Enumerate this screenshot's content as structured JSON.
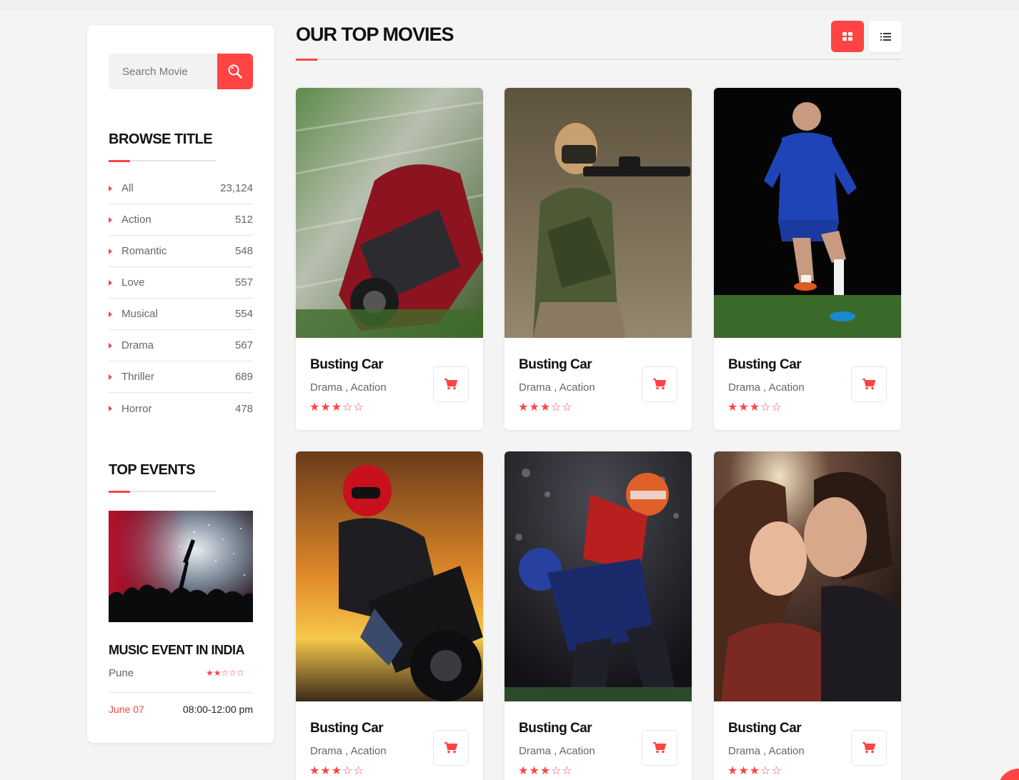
{
  "search": {
    "placeholder": "Search Movie"
  },
  "browse": {
    "heading": "BROWSE TITLE",
    "categories": [
      {
        "label": "All",
        "count": "23,124"
      },
      {
        "label": "Action",
        "count": "512"
      },
      {
        "label": "Romantic",
        "count": "548"
      },
      {
        "label": "Love",
        "count": "557"
      },
      {
        "label": "Musical",
        "count": "554"
      },
      {
        "label": "Drama",
        "count": "567"
      },
      {
        "label": "Thriller",
        "count": "689"
      },
      {
        "label": "Horror",
        "count": "478"
      }
    ]
  },
  "events": {
    "heading": "TOP EVENTS",
    "item": {
      "title": "MUSIC EVENT IN INDIA",
      "city": "Pune",
      "rating": 2,
      "rating_max": 5,
      "date": "June 07",
      "time": "08:00-12:00 pm",
      "image_icon": "concert-crowd-photo"
    }
  },
  "main": {
    "title": "OUR TOP MOVIES",
    "view_modes": [
      {
        "name": "grid-view",
        "icon": "grid-icon",
        "active": true
      },
      {
        "name": "list-view",
        "icon": "list-icon",
        "active": false
      }
    ]
  },
  "movies": [
    {
      "title": "Busting Car",
      "genre": "Drama , Acation",
      "rating": 3,
      "rating_max": 5,
      "poster": "crashed-car-photo"
    },
    {
      "title": "Busting Car",
      "genre": "Drama , Acation",
      "rating": 3,
      "rating_max": 5,
      "poster": "paintball-girl-photo"
    },
    {
      "title": "Busting Car",
      "genre": "Drama , Acation",
      "rating": 3,
      "rating_max": 5,
      "poster": "soccer-player-photo"
    },
    {
      "title": "Busting Car",
      "genre": "Drama , Acation",
      "rating": 3,
      "rating_max": 5,
      "poster": "motorcycle-rider-photo"
    },
    {
      "title": "Busting Car",
      "genre": "Drama , Acation",
      "rating": 3,
      "rating_max": 5,
      "poster": "football-players-photo"
    },
    {
      "title": "Busting Car",
      "genre": "Drama , Acation",
      "rating": 3,
      "rating_max": 5,
      "poster": "couple-kiss-photo"
    }
  ],
  "colors": {
    "accent": "#ff4444",
    "background": "#f4f4f4",
    "card": "#ffffff",
    "text_dark": "#111111",
    "text_muted": "#666666"
  }
}
